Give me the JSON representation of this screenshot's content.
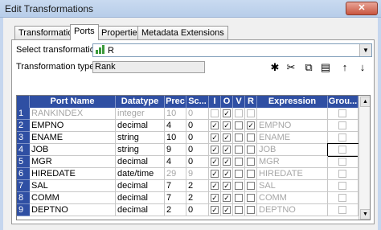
{
  "window": {
    "title": "Edit Transformations",
    "close_glyph": "✕"
  },
  "tabs": [
    "Transformation",
    "Ports",
    "Properties",
    "Metadata Extensions"
  ],
  "form": {
    "select_label": "Select transformation:",
    "select_value": "R",
    "type_label": "Transformation type:",
    "type_value": "Rank"
  },
  "toolbar": [
    "new-port-icon",
    "cut-icon",
    "copy-icon",
    "paste-icon",
    "move-up-icon",
    "move-down-icon"
  ],
  "toolbar_glyphs": [
    "✱",
    "✂",
    "⧉",
    "▤",
    "↑",
    "↓"
  ],
  "columns": [
    "Port Name",
    "Datatype",
    "Prec",
    "Sc...",
    "I",
    "O",
    "V",
    "R",
    "Expression",
    "Grou..."
  ],
  "rows": [
    {
      "n": "1",
      "name": "RANKINDEX",
      "type": "integer",
      "prec": "10",
      "scale": "0",
      "I": false,
      "O": true,
      "V": false,
      "R": false,
      "expr": "",
      "group": false,
      "gray": true
    },
    {
      "n": "2",
      "name": "EMPNO",
      "type": "decimal",
      "prec": "4",
      "scale": "0",
      "I": true,
      "O": true,
      "V": false,
      "R": true,
      "expr": "EMPNO",
      "group": false,
      "gray": false
    },
    {
      "n": "3",
      "name": "ENAME",
      "type": "string",
      "prec": "10",
      "scale": "0",
      "I": true,
      "O": true,
      "V": false,
      "R": false,
      "expr": "ENAME",
      "group": false,
      "gray": false
    },
    {
      "n": "4",
      "name": "JOB",
      "type": "string",
      "prec": "9",
      "scale": "0",
      "I": true,
      "O": true,
      "V": false,
      "R": false,
      "expr": "JOB",
      "group": false,
      "gray": false
    },
    {
      "n": "5",
      "name": "MGR",
      "type": "decimal",
      "prec": "4",
      "scale": "0",
      "I": true,
      "O": true,
      "V": false,
      "R": false,
      "expr": "MGR",
      "group": false,
      "gray": false
    },
    {
      "n": "6",
      "name": "HIREDATE",
      "type": "date/time",
      "prec": "29",
      "scale": "9",
      "I": true,
      "O": true,
      "V": false,
      "R": false,
      "expr": "HIREDATE",
      "group": false,
      "gray": false
    },
    {
      "n": "7",
      "name": "SAL",
      "type": "decimal",
      "prec": "7",
      "scale": "2",
      "I": true,
      "O": true,
      "V": false,
      "R": false,
      "expr": "SAL",
      "group": false,
      "gray": false
    },
    {
      "n": "8",
      "name": "COMM",
      "type": "decimal",
      "prec": "7",
      "scale": "2",
      "I": true,
      "O": true,
      "V": false,
      "R": false,
      "expr": "COMM",
      "group": false,
      "gray": false
    },
    {
      "n": "9",
      "name": "DEPTNO",
      "type": "decimal",
      "prec": "2",
      "scale": "0",
      "I": true,
      "O": true,
      "V": false,
      "R": false,
      "expr": "DEPTNO",
      "group": false,
      "gray": false
    }
  ]
}
